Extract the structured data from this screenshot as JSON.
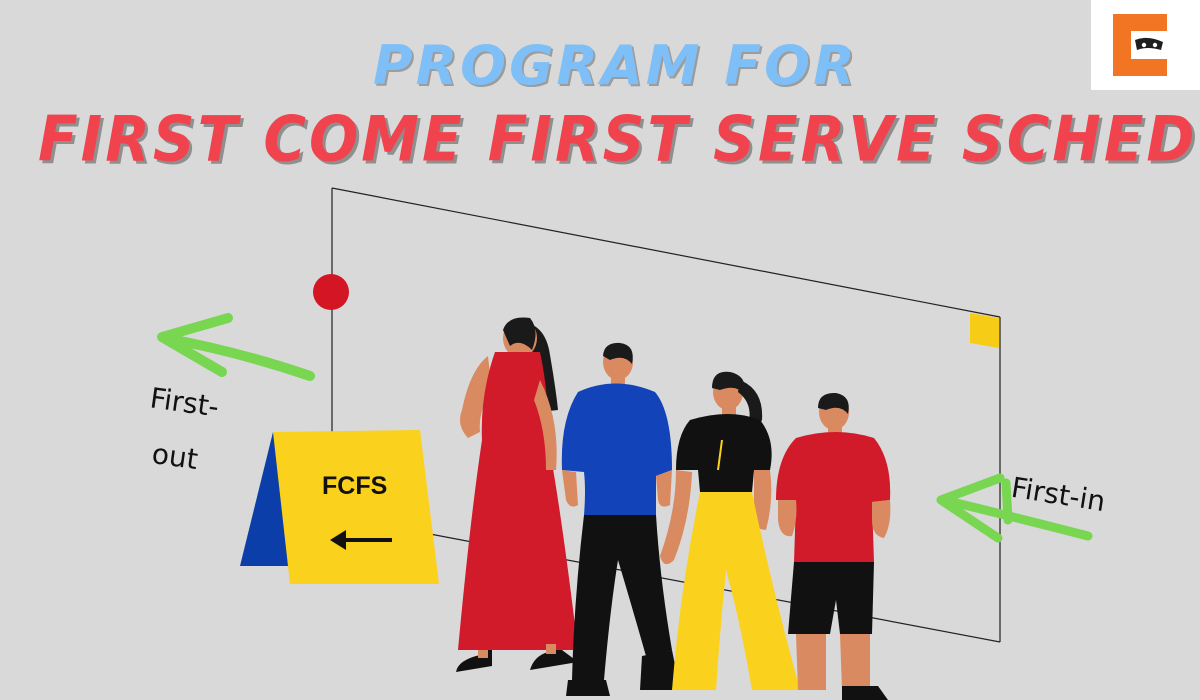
{
  "title": {
    "line1": "PROGRAM FOR",
    "line2": "FIRST COME FIRST SERVE SCHEDULING"
  },
  "sign": {
    "label": "FCFS"
  },
  "labels": {
    "first_out_line1": "First-",
    "first_out_line2": "out",
    "first_in": "First-in"
  },
  "icons": {
    "logo": "coding-ninjas-logo",
    "sign_arrow": "left-arrow-icon",
    "exit_arrow": "green-left-arrow-icon",
    "entry_arrow": "green-left-arrow-icon"
  },
  "colors": {
    "background": "#d9d9d9",
    "title_top": "#7fbff7",
    "title_bottom": "#f0434d",
    "sign_yellow": "#fad11c",
    "sign_blue": "#0b3ea8",
    "arrow_green": "#78d651",
    "logo_orange": "#f27524"
  }
}
